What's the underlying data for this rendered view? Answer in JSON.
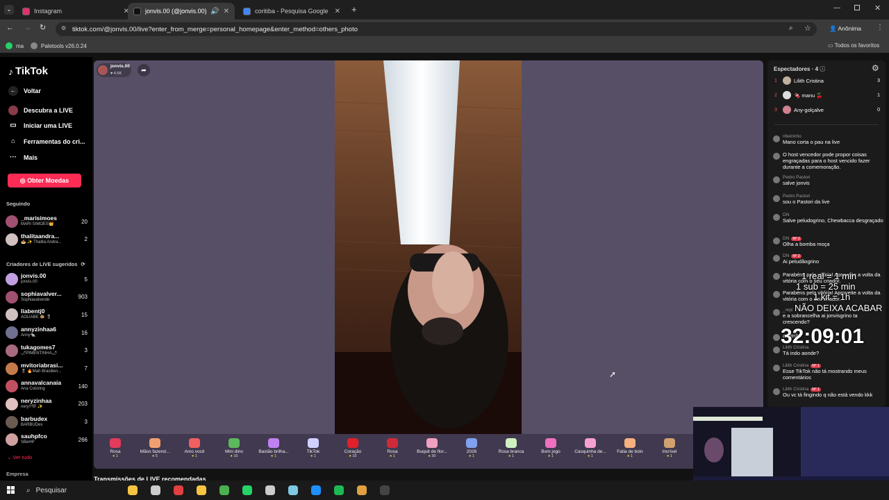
{
  "browser": {
    "tabs": [
      {
        "title": "Instagram",
        "favicon": "instagram-icon",
        "active": false
      },
      {
        "title": "jonvis.00 (@jonvis.00) com",
        "favicon": "tiktok-icon",
        "active": true
      },
      {
        "title": "coritiba - Pesquisa Google",
        "favicon": "google-icon",
        "active": false
      }
    ],
    "url": "tiktok.com/@jonvis.00/live?enter_from_merge=personal_homepage&enter_method=others_photo",
    "profile_label": "Anônima",
    "bookmarks": [
      {
        "label": "ma",
        "icon": "whatsapp-icon"
      },
      {
        "label": "Paletools v26.0.24",
        "icon": "globe-icon"
      }
    ],
    "all_bookmarks": "Todos os favoritos"
  },
  "sidebar": {
    "logo": "TikTok",
    "back": "Voltar",
    "nav": [
      {
        "label": "Descubra a LIVE",
        "icon": "live-icon"
      },
      {
        "label": "Iniciar uma LIVE",
        "icon": "camera-icon"
      },
      {
        "label": "Ferramentas do cri...",
        "icon": "home-icon"
      },
      {
        "label": "Mais",
        "icon": "more-icon"
      }
    ],
    "coins_button": "Obter Moedas",
    "following_title": "Seguindo",
    "following": [
      {
        "name": "_marisimoes",
        "sub": "MARI SIMÕES👑",
        "count": "20"
      },
      {
        "name": "thalitaandra...",
        "sub": "🍝 ✨ Thalita Andra...",
        "count": "2"
      }
    ],
    "suggested_title": "Criadores de LIVE sugeridos",
    "suggested": [
      {
        "name": "jonvis.00",
        "sub": "jonvis.00",
        "count": "5"
      },
      {
        "name": "sophiavalver...",
        "sub": "Sophiavalverde",
        "count": "903"
      },
      {
        "name": "liabentj0",
        "sub": "AOLIABE 🐵 🎖",
        "count": "15"
      },
      {
        "name": "annyzinhaa6",
        "sub": "Anny🐀",
        "count": "16"
      },
      {
        "name": "tukagomes7",
        "sub": "🌶PIMENTINHA🌶",
        "count": "3"
      },
      {
        "name": "mvitoriabrasi...",
        "sub": "🎖 🔥Mah Brasilien...",
        "count": "7"
      },
      {
        "name": "annavalcanaia",
        "sub": "Ana Coloring",
        "count": "140"
      },
      {
        "name": "neryzinhaa",
        "sub": "nery!!🖤 ✨",
        "count": "203"
      },
      {
        "name": "barbudex",
        "sub": "BARBUDex",
        "count": "3"
      },
      {
        "name": "sauhpfco",
        "sub": "SBeHP",
        "count": "266"
      }
    ],
    "see_all": "Ver tudo",
    "company": "Empresa"
  },
  "stream": {
    "host": "jonvis.00",
    "likes": "4.5K",
    "recommended_title": "Transmissões de LIVE recomendadas",
    "gifts": [
      {
        "name": "Rosa",
        "price": "1",
        "color": "#e23b5b"
      },
      {
        "name": "Mãos fazend...",
        "price": "5",
        "color": "#f0a070"
      },
      {
        "name": "Amo você",
        "price": "1",
        "color": "#f06060"
      },
      {
        "name": "Mini dino",
        "price": "10",
        "color": "#5cb85c"
      },
      {
        "name": "Bastão brilha...",
        "price": "1",
        "color": "#c080f0"
      },
      {
        "name": "TikTok",
        "price": "1",
        "color": "#d0d0ff"
      },
      {
        "name": "Coração",
        "price": "10",
        "color": "#e0202a"
      },
      {
        "name": "Rosa",
        "price": "1",
        "color": "#d02a3a"
      },
      {
        "name": "Buquê de flor...",
        "price": "30",
        "color": "#f0a0c0"
      },
      {
        "name": "2026",
        "price": "1",
        "color": "#80a0f0"
      },
      {
        "name": "Rosa branca",
        "price": "1",
        "color": "#d0f0c0"
      },
      {
        "name": "Bom jogo",
        "price": "1",
        "color": "#f070c0"
      },
      {
        "name": "Casquinha de...",
        "price": "1",
        "color": "#f5a0d0"
      },
      {
        "name": "Fatia de bolo",
        "price": "1",
        "color": "#f5b080"
      },
      {
        "name": "Incrível",
        "price": "1",
        "color": "#d0a070"
      }
    ]
  },
  "viewers": {
    "title": "Espectadores · 4",
    "list": [
      {
        "rank": "1",
        "name": "Lilith Cristina",
        "count": "3"
      },
      {
        "rank": "2",
        "name": "🍫 manu 🍒",
        "count": "1"
      },
      {
        "rank": "3",
        "name": "Any-golçalve",
        "count": "0"
      }
    ]
  },
  "chat": [
    {
      "name": "ribeirinho",
      "text": "Mano corta o pau na live",
      "badge": ""
    },
    {
      "name": "",
      "text": "O host vencedor pode propor coisas engraçadas para o host vencido fazer durante a comemoração.",
      "badge": ""
    },
    {
      "name": "Pedro Pastori",
      "text": "salve jonvis",
      "badge": ""
    },
    {
      "name": "Pedro Pastori",
      "text": "sou o Pastori da live",
      "badge": ""
    },
    {
      "name": "DN",
      "text": "Salve peludogrino, Chewbacca desgraçado",
      "badge": ""
    },
    {
      "name": "DN",
      "text": "Olha a bomba moça",
      "badge": "Nº 2"
    },
    {
      "name": "DN",
      "text": "Ai peludãogrino",
      "badge": "Nº 2"
    },
    {
      "name": "",
      "text": "Parabéns pela vitória! Aproveite a volta da vitória com o seu criador.",
      "badge": ""
    },
    {
      "name": "",
      "text": "Parabéns pela vitória! Aproveite a volta da vitória com o seu criador.",
      "badge": ""
    },
    {
      "name": "_repi",
      "text": "e a sobrancelha ai jonvisgrino ta crescendo?",
      "badge": ""
    },
    {
      "name": "",
      "text": "anfitrião",
      "badge": ""
    },
    {
      "name": "Lilith Cristina",
      "text": "Tá indo aonde?",
      "badge": ""
    },
    {
      "name": "Lilith Cristina",
      "text": "Esse TikTok não tá mostrando meus comentários",
      "badge": "Nº 1"
    },
    {
      "name": "Lilith Cristina",
      "text": "Ou vc tá fingindo q não está vendo kkk",
      "badge": "Nº 1"
    }
  ],
  "overlay": {
    "line1": "1 real = 1 min",
    "line2": "1 sub = 25 min",
    "line3": "1 kit = 1h",
    "line4": "NÃO DEIXA ACABAR",
    "timer": "32:09:01"
  },
  "taskbar": {
    "search": "Pesquisar"
  }
}
